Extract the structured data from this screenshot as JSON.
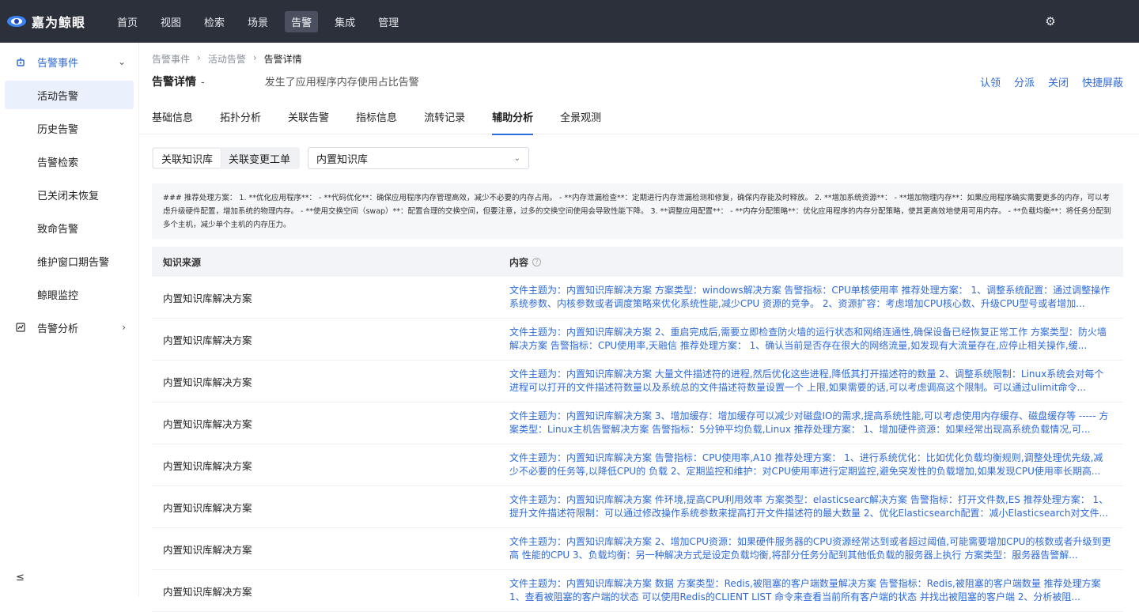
{
  "app": {
    "logo_text": "嘉为鲸眼"
  },
  "nav": {
    "items": [
      "首页",
      "视图",
      "检索",
      "场景",
      "告警",
      "集成",
      "管理"
    ],
    "active_index": 4
  },
  "sidebar": {
    "group_alert_events": "告警事件",
    "items": [
      "活动告警",
      "历史告警",
      "告警检索",
      "已关闭未恢复",
      "致命告警",
      "维护窗口期告警",
      "鲸眼监控"
    ],
    "active_index": 0,
    "group_alert_analysis": "告警分析",
    "collapse_icon": "≤"
  },
  "breadcrumb": {
    "level1": "告警事件",
    "level2": "活动告警",
    "current": "告警详情"
  },
  "header": {
    "title": "告警详情",
    "dash": "-",
    "description": "发生了应用程序内存使用占比告警"
  },
  "actions": [
    "认领",
    "分派",
    "关闭",
    "快捷屏蔽"
  ],
  "tabs": [
    "基础信息",
    "拓扑分析",
    "关联告警",
    "指标信息",
    "流转记录",
    "辅助分析",
    "全景观测"
  ],
  "active_tab": 5,
  "filter": {
    "segments": [
      "关联知识库",
      "关联变更工单"
    ],
    "active_segment": 0,
    "select_value": "内置知识库"
  },
  "advice_text": "### 推荐处理方案： 1. **优化应用程序**： - **代码优化**：确保应用程序内存管理高效，减少不必要的内存占用。 - **内存泄漏检查**：定期进行内存泄漏检测和修复，确保内存能及时释放。 2. **增加系统资源**： - **增加物理内存**：如果应用程序确实需要更多的内存，可以考虑升级硬件配置，增加系统的物理内存。 - **使用交换空间（swap）**：配置合理的交换空间，但要注意，过多的交换空间使用会导致性能下降。 3. **调整应用配置**： - **内存分配策略**：优化应用程序的内存分配策略，使其更高效地使用可用内存。 - **负载均衡**：将任务分配到多个主机，减少单个主机的内存压力。",
  "table": {
    "headers": {
      "source": "知识来源",
      "content": "内容"
    },
    "rows": [
      {
        "source": "内置知识库解决方案",
        "content": "文件主题为：内置知识库解决方案 方案类型：windows解决方案 告警指标：CPU单核使用率 推荐处理方案： 1、调整系统配置：通过调整操作系统参数、内核参数或者调度策略来优化系统性能,减少CPU 资源的竞争。 2、资源扩容：考虑增加CPU核心数、升级CPU型号或者增加..."
      },
      {
        "source": "内置知识库解决方案",
        "content": "文件主题为：内置知识库解决方案 2、重启完成后,需要立即检查防火墙的运行状态和网络连通性,确保设备已经恢复正常工作 方案类型：防火墙解决方案 告警指标：CPU使用率,天融信 推荐处理方案： 1、确认当前是否存在很大的网络流量,如发现有大流量存在,应停止相关操作,缓..."
      },
      {
        "source": "内置知识库解决方案",
        "content": "文件主题为：内置知识库解决方案 大量文件描述符的进程,然后优化这些进程,降低其打开描述符的数量 2、调整系统限制：Linux系统会对每个进程可以打开的文件描述符数量以及系统总的文件描述符数量设置一个 上限,如果需要的话,可以考虑调高这个限制。可以通过ulimit命令..."
      },
      {
        "source": "内置知识库解决方案",
        "content": "文件主题为：内置知识库解决方案 3、增加缓存：增加缓存可以减少对磁盘IO的需求,提高系统性能,可以考虑使用内存缓存、磁盘缓存等 ----- 方案类型：Linux主机告警解决方案 告警指标：5分钟平均负载,Linux 推荐处理方案： 1、增加硬件资源：如果经常出现高系统负载情况,可..."
      },
      {
        "source": "内置知识库解决方案",
        "content": "文件主题为：内置知识库解决方案 告警指标：CPU使用率,A10 推荐处理方案： 1、进行系统优化：比如优化负载均衡规则,调整处理优先级,减少不必要的任务等,以降低CPU的 负载 2、定期监控和维护：对CPU使用率进行定期监控,避免突发性的负载增加,如果发现CPU使用率长期高..."
      },
      {
        "source": "内置知识库解决方案",
        "content": "文件主题为：内置知识库解决方案 件环境,提高CPU利用效率 方案类型：elasticsearc解决方案 告警指标：打开文件数,ES 推荐处理方案： 1、提升文件描述符限制：可以通过修改操作系统参数来提高打开文件描述符的最大数量 2、优化Elasticsearch配置：减小Elasticsearch对文件..."
      },
      {
        "source": "内置知识库解决方案",
        "content": "文件主题为：内置知识库解决方案 2、增加CPU资源：如果硬件服务器的CPU资源经常达到或者超过阈值,可能需要增加CPU的核数或者升级到更高 性能的CPU 3、负载均衡：另一种解决方式是设定负载均衡,将部分任务分配到其他低负载的服务器上执行 方案类型：服务器告警解..."
      },
      {
        "source": "内置知识库解决方案",
        "content": "文件主题为：内置知识库解决方案 数据 方案类型：Redis,被阻塞的客户端数量解决方案 告警指标：Redis,被阻塞的客户端数量 推荐处理方案 1、查看被阻塞的客户端的状态 可以使用Redis的CLIENT LIST 命令来查看当前所有客户端的状态 并找出被阻塞的客户端 2、分析被阻..."
      }
    ]
  },
  "colors": {
    "topbar": "#2b303b",
    "accent": "#2e6ad9",
    "sidebar_active": "#eaf0fc"
  }
}
